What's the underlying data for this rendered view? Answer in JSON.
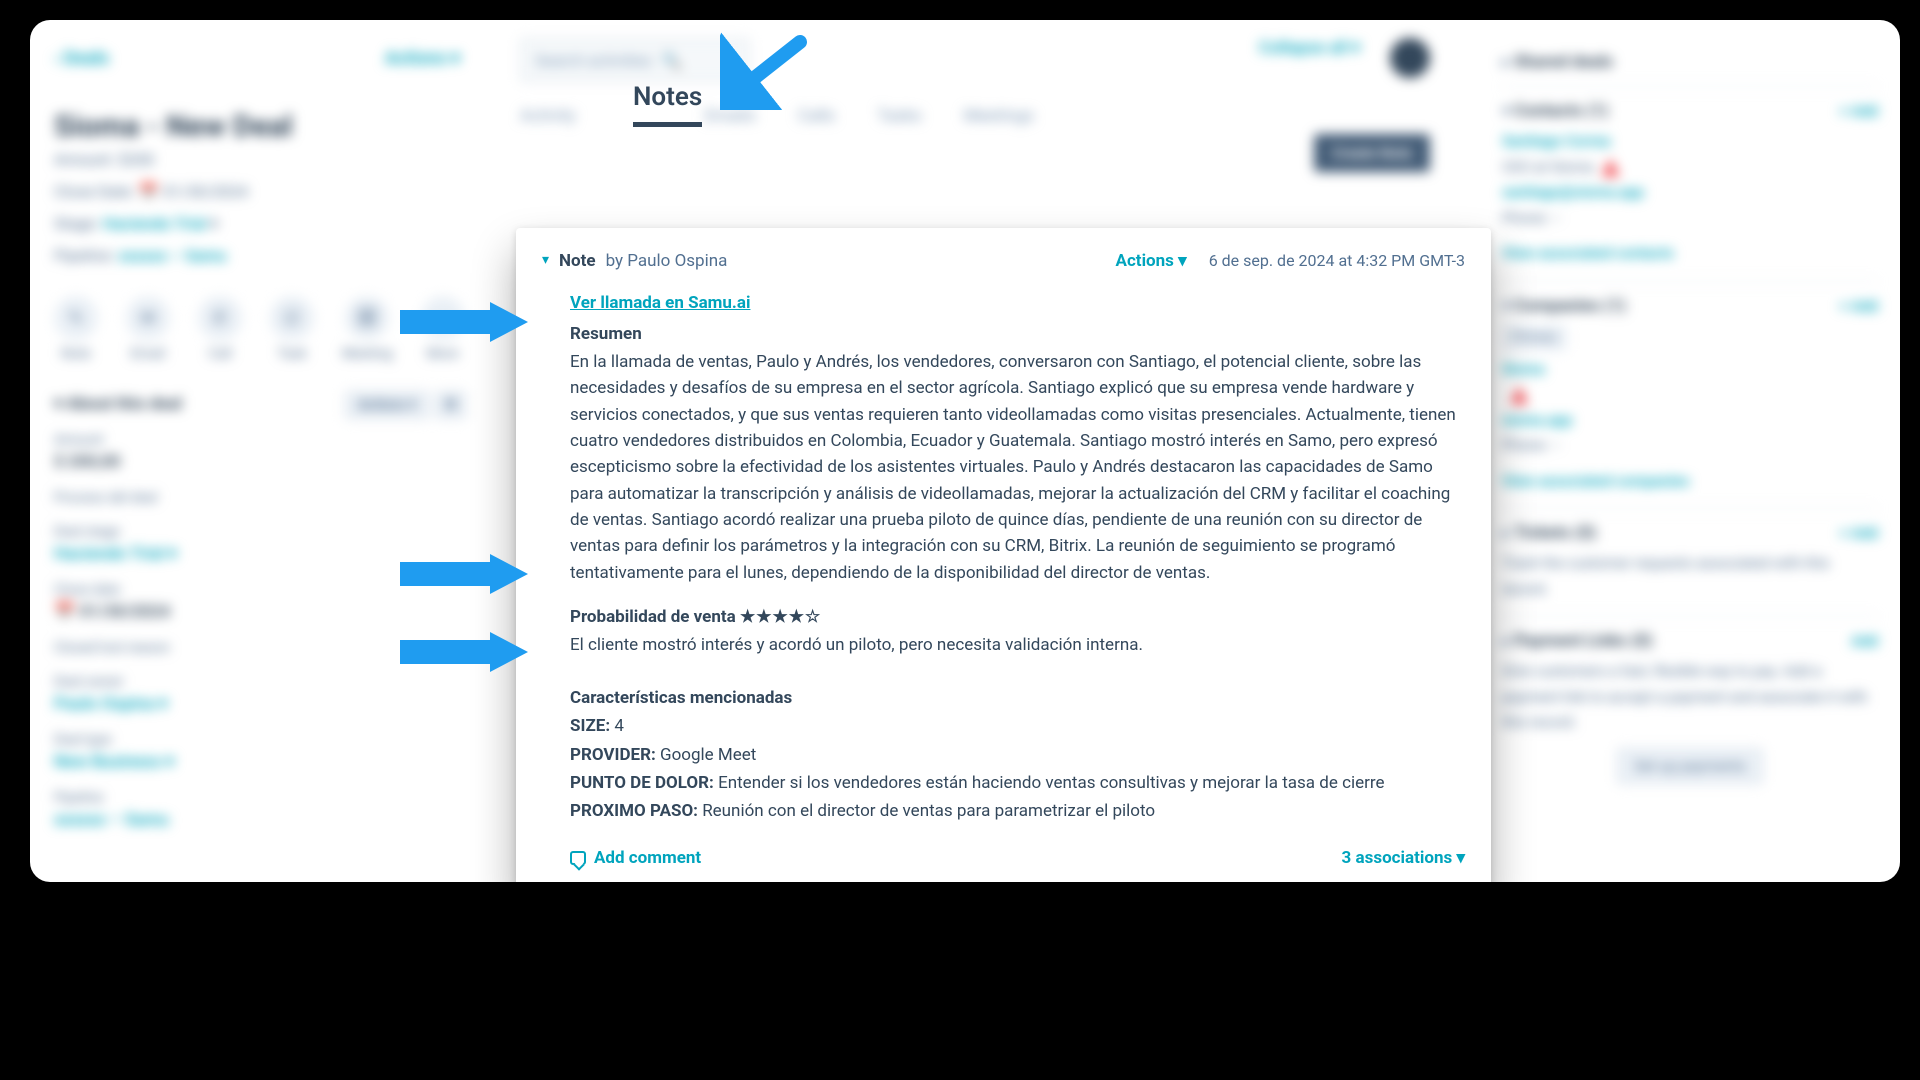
{
  "annotations": {
    "arrow_top_target": "Notes tab",
    "arrow_1_target": "Resumen section",
    "arrow_2_target": "Probabilidad de venta section",
    "arrow_3_target": "Características mencionadas section"
  },
  "left_panel": {
    "back": "Deals",
    "actions": "Actions",
    "deal_title": "Sioma - New Deal",
    "amount_line": "Amount: $200",
    "close_date_label": "Close Date:",
    "close_date_value": "01/30/2024",
    "stage_label": "Stage:",
    "stage_value": "Haciendo Trial",
    "pipeline_label": "Pipeline:",
    "pipeline_value": "xxxxxx – Samu",
    "icons": {
      "note": "Note",
      "email": "Email",
      "call": "Call",
      "task": "Task",
      "meeting": "Meeting",
      "more": "More"
    },
    "about_header": "About this deal",
    "about_actions": "Actions",
    "amount_label": "Amount",
    "amount_value": "$ 200,00",
    "process_label": "Proceso del deal",
    "deal_stage_label": "Deal stage",
    "deal_stage_value": "Haciendo Trial",
    "close_date2_label": "Close date",
    "close_date2_value": "01/30/2024",
    "closed_lost_label": "Closed lost reason",
    "owner_label": "Deal owner",
    "owner_value": "Paulo Ospina",
    "type_label": "Deal type",
    "type_value": "New Business",
    "pipeline2_label": "Pipeline",
    "pipeline2_value": "xxxxxx – Samu"
  },
  "mid_panel": {
    "search_placeholder": "Search activities",
    "collapse": "Collapse all",
    "tabs": {
      "activity": "Activity",
      "notes": "Notes",
      "emails": "Emails",
      "calls": "Calls",
      "tasks": "Tasks",
      "meetings": "Meetings"
    },
    "create_note": "Create Note"
  },
  "note": {
    "chev_text": "▾",
    "title": "Note",
    "by_prefix": "by",
    "author": "Paulo Ospina",
    "actions": "Actions",
    "date": "6 de sep. de 2024 at 4:32 PM GMT-3",
    "link": "Ver llamada en Samu.ai",
    "resumen_h": "Resumen",
    "resumen_body": "En la llamada de ventas, Paulo y Andrés, los vendedores, conversaron con Santiago, el potencial cliente, sobre las necesidades y desafíos de su empresa en el sector agrícola. Santiago explicó que su empresa vende hardware y servicios conectados, y que sus ventas requieren tanto videollamadas como visitas presenciales. Actualmente, tienen cuatro vendedores distribuidos en Colombia, Ecuador y Guatemala. Santiago mostró interés en Samo, pero expresó escepticismo sobre la efectividad de los asistentes virtuales. Paulo y Andrés destacaron las capacidades de Samo para automatizar la transcripción y análisis de videollamadas, mejorar la actualización del CRM y facilitar el coaching de ventas. Santiago acordó realizar una prueba piloto de quince días, pendiente de una reunión con su director de ventas para definir los parámetros y la integración con su CRM, Bitrix. La reunión de seguimiento se programó tentativamente para el lunes, dependiendo de la disponibilidad del director de ventas.",
    "prob_h": "Probabilidad de venta",
    "prob_stars": "★★★★☆",
    "prob_body": "El cliente mostró interés y acordó un piloto, pero necesita validación interna.",
    "caract_h": "Características mencionadas",
    "size_label": "SIZE:",
    "size_value": "4",
    "provider_label": "PROVIDER:",
    "provider_value": "Google Meet",
    "pain_label": "PUNTO DE DOLOR:",
    "pain_value": "Entender si los vendedores están haciendo ventas consultivas y mejorar la tasa de cierre",
    "next_label": "PROXIMO PASO:",
    "next_value": "Reunión con el director de ventas para parametrizar el piloto",
    "add_comment": "Add comment",
    "associations": "3 associations"
  },
  "right_panel": {
    "shared": {
      "title": "Shared deals"
    },
    "contacts": {
      "title": "Contacts (1)",
      "add": "+ Add",
      "name": "Santiago Correa",
      "sub": "CEO at Sioma",
      "email": "santiago@sioma.app",
      "phone": "Phone: --",
      "view": "View associated contacts"
    },
    "companies": {
      "title": "Companies (1)",
      "add": "+ Add",
      "primary": "Primary",
      "name": "Sioma",
      "domain": "sioma.app",
      "phone": "Phone: --",
      "view": "View associated companies"
    },
    "tickets": {
      "title": "Tickets (0)",
      "add": "+ Add",
      "body": "Track the customer requests associated with this record."
    },
    "payments": {
      "title": "Payment Links (0)",
      "add": "Add",
      "body": "Give customers a fast, flexible way to pay. Add a payment link to accept a payment and associate it with this record.",
      "button": "Set up payments"
    }
  }
}
